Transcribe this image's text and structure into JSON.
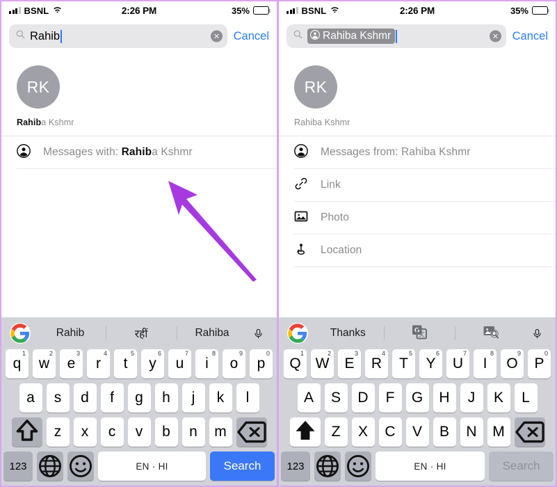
{
  "panels": [
    {
      "id": "left",
      "status": {
        "carrier": "BSNL",
        "time": "2:26 PM",
        "battery_pct": "35%",
        "battery_level": 35,
        "signal_icon": "cellular-signal-icon",
        "wifi_icon": "wifi-icon",
        "battery_icon": "battery-icon"
      },
      "search": {
        "icon": "search-icon",
        "value": "Rahib",
        "placeholder": "Search",
        "has_token": false,
        "clear_icon": "clear-circle-icon",
        "cancel_label": "Cancel"
      },
      "contact": {
        "avatar_initials": "RK",
        "name_bold": "Rahib",
        "name_rest": "a Kshmr",
        "avatar_name": "contact-avatar"
      },
      "rows": [
        {
          "icon": "person-circle-icon",
          "label_prefix": "Messages with: ",
          "label_bold": "Rahib",
          "label_suffix": "a Kshmr"
        }
      ],
      "suggestions": {
        "logo": "google-logo-icon",
        "items": [
          {
            "type": "text",
            "label": "Rahib",
            "name": "suggestion-rahib"
          },
          {
            "type": "text",
            "label": "रहीं",
            "name": "suggestion-hindi"
          },
          {
            "type": "text",
            "label": "Rahiba",
            "name": "suggestion-rahiba"
          }
        ],
        "mic": "microphone-icon"
      },
      "keyboard": {
        "row1": [
          {
            "k": "q",
            "n": "1"
          },
          {
            "k": "w",
            "n": "2"
          },
          {
            "k": "e",
            "n": "3"
          },
          {
            "k": "r",
            "n": "4"
          },
          {
            "k": "t",
            "n": "5"
          },
          {
            "k": "y",
            "n": "6"
          },
          {
            "k": "u",
            "n": "7"
          },
          {
            "k": "i",
            "n": "8"
          },
          {
            "k": "o",
            "n": "9"
          },
          {
            "k": "p",
            "n": "0"
          }
        ],
        "row2": [
          {
            "k": "a"
          },
          {
            "k": "s"
          },
          {
            "k": "d"
          },
          {
            "k": "f"
          },
          {
            "k": "g"
          },
          {
            "k": "h"
          },
          {
            "k": "j"
          },
          {
            "k": "k"
          },
          {
            "k": "l"
          }
        ],
        "row3": [
          {
            "k": "z"
          },
          {
            "k": "x"
          },
          {
            "k": "c"
          },
          {
            "k": "v"
          },
          {
            "k": "b"
          },
          {
            "k": "n"
          },
          {
            "k": "m"
          }
        ],
        "shift_icon": "shift-icon",
        "shift_active": false,
        "backspace_icon": "backspace-icon",
        "numeric_label": "123",
        "globe_icon": "globe-icon",
        "emoji_icon": "emoji-icon",
        "space_label": "EN · HI",
        "action_label": "Search",
        "action_disabled": false
      },
      "annotation": {
        "arrow": "purple-arrow-annotation",
        "color": "#a63ae0"
      }
    },
    {
      "id": "right",
      "status": {
        "carrier": "BSNL",
        "time": "2:26 PM",
        "battery_pct": "35%",
        "battery_level": 35,
        "signal_icon": "cellular-signal-icon",
        "wifi_icon": "wifi-icon",
        "battery_icon": "battery-icon"
      },
      "search": {
        "icon": "search-icon",
        "value": "Rahiba Kshmr",
        "placeholder": "Search",
        "has_token": true,
        "token_icon": "person-circle-icon",
        "clear_icon": "clear-circle-icon",
        "cancel_label": "Cancel"
      },
      "contact": {
        "avatar_initials": "RK",
        "name_bold": "",
        "name_rest": "Rahiba Kshmr",
        "avatar_name": "contact-avatar"
      },
      "rows": [
        {
          "icon": "person-circle-icon",
          "label_prefix": "Messages from: Rahiba Kshmr",
          "label_bold": "",
          "label_suffix": ""
        },
        {
          "icon": "link-icon",
          "label_prefix": "Link",
          "label_bold": "",
          "label_suffix": ""
        },
        {
          "icon": "photo-icon",
          "label_prefix": "Photo",
          "label_bold": "",
          "label_suffix": ""
        },
        {
          "icon": "location-icon",
          "label_prefix": "Location",
          "label_bold": "",
          "label_suffix": ""
        }
      ],
      "suggestions": {
        "logo": "google-logo-icon",
        "items": [
          {
            "type": "text",
            "label": "Thanks",
            "name": "suggestion-thanks"
          },
          {
            "type": "icon",
            "label": "translate-icon",
            "name": "suggestion-translate"
          },
          {
            "type": "icon",
            "label": "image-search-icon",
            "name": "suggestion-image-search"
          }
        ],
        "mic": "microphone-icon"
      },
      "keyboard": {
        "row1": [
          {
            "k": "Q",
            "n": "1"
          },
          {
            "k": "W",
            "n": "2"
          },
          {
            "k": "E",
            "n": "3"
          },
          {
            "k": "R",
            "n": "4"
          },
          {
            "k": "T",
            "n": "5"
          },
          {
            "k": "Y",
            "n": "6"
          },
          {
            "k": "U",
            "n": "7"
          },
          {
            "k": "I",
            "n": "8"
          },
          {
            "k": "O",
            "n": "9"
          },
          {
            "k": "P",
            "n": "0"
          }
        ],
        "row2": [
          {
            "k": "A"
          },
          {
            "k": "S"
          },
          {
            "k": "D"
          },
          {
            "k": "F"
          },
          {
            "k": "G"
          },
          {
            "k": "H"
          },
          {
            "k": "J"
          },
          {
            "k": "K"
          },
          {
            "k": "L"
          }
        ],
        "row3": [
          {
            "k": "Z"
          },
          {
            "k": "X"
          },
          {
            "k": "C"
          },
          {
            "k": "V"
          },
          {
            "k": "B"
          },
          {
            "k": "N"
          },
          {
            "k": "M"
          }
        ],
        "shift_icon": "shift-icon",
        "shift_active": true,
        "backspace_icon": "backspace-icon",
        "numeric_label": "123",
        "globe_icon": "globe-icon",
        "emoji_icon": "emoji-icon",
        "space_label": "EN · HI",
        "action_label": "Search",
        "action_disabled": true
      },
      "annotation": {
        "arrow": "purple-arrow-annotation",
        "color": "#a63ae0"
      }
    }
  ],
  "theme": {
    "accent_blue": "#2a7cff",
    "key_action_blue": "#3b78f7",
    "keyboard_bg": "#d1d3d9",
    "field_bg": "#e7e7e9",
    "avatar_bg": "#9fa0a8",
    "muted_text": "#8a8a8f",
    "arrow_purple": "#a63ae0"
  }
}
